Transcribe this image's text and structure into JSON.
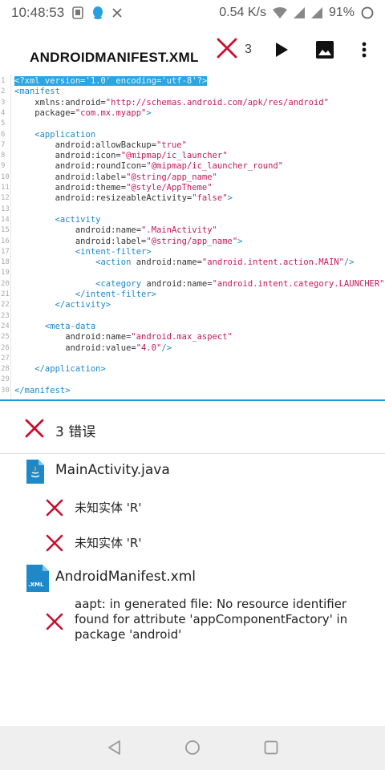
{
  "status_bar": {
    "time": "10:48:53",
    "net_speed": "0.54 K/s",
    "battery": "91%",
    "icons": [
      "file-icon",
      "qq-icon",
      "close-icon",
      "wifi-icon",
      "signal-icon",
      "signal-icon",
      "battery-icon"
    ]
  },
  "toolbar": {
    "title": "ANDROIDMANIFEST.XML",
    "error_count": "3",
    "actions": [
      "error-icon",
      "play-icon",
      "image-icon",
      "more-vert-icon"
    ]
  },
  "editor": {
    "lines": [
      {
        "n": "1",
        "parts": [
          [
            "sel",
            "<?xml version='1.0' encoding='utf-8'?>"
          ]
        ]
      },
      {
        "n": "2",
        "parts": [
          [
            "tag",
            "<manifest"
          ]
        ]
      },
      {
        "n": "3",
        "parts": [
          [
            "attr",
            "    xmlns:android="
          ],
          [
            "val",
            "\"http://schemas.android.com/apk/res/android\""
          ]
        ]
      },
      {
        "n": "4",
        "parts": [
          [
            "attr",
            "    package="
          ],
          [
            "val",
            "\"com.mx.myapp\""
          ],
          [
            "tag",
            ">"
          ]
        ]
      },
      {
        "n": "5",
        "parts": []
      },
      {
        "n": "6",
        "parts": [
          [
            "tag",
            "    <application"
          ]
        ]
      },
      {
        "n": "7",
        "parts": [
          [
            "attr",
            "        android:allowBackup="
          ],
          [
            "val",
            "\"true\""
          ]
        ]
      },
      {
        "n": "8",
        "parts": [
          [
            "attr",
            "        android:icon="
          ],
          [
            "val",
            "\"@mipmap/ic_launcher\""
          ]
        ]
      },
      {
        "n": "9",
        "parts": [
          [
            "attr",
            "        android:roundIcon="
          ],
          [
            "val",
            "\"@mipmap/ic_launcher_round\""
          ]
        ]
      },
      {
        "n": "10",
        "parts": [
          [
            "attr",
            "        android:label="
          ],
          [
            "val",
            "\"@string/app_name\""
          ]
        ]
      },
      {
        "n": "11",
        "parts": [
          [
            "attr",
            "        android:theme="
          ],
          [
            "val",
            "\"@style/AppTheme\""
          ]
        ]
      },
      {
        "n": "12",
        "parts": [
          [
            "attr",
            "        android:resizeableActivity="
          ],
          [
            "val",
            "\"false\""
          ],
          [
            "tag",
            ">"
          ]
        ]
      },
      {
        "n": "13",
        "parts": []
      },
      {
        "n": "14",
        "parts": [
          [
            "tag",
            "        <activity"
          ]
        ]
      },
      {
        "n": "15",
        "parts": [
          [
            "attr",
            "            android:name="
          ],
          [
            "val",
            "\".MainActivity\""
          ]
        ]
      },
      {
        "n": "16",
        "parts": [
          [
            "attr",
            "            android:label="
          ],
          [
            "val",
            "\"@string/app_name\""
          ],
          [
            "tag",
            ">"
          ]
        ]
      },
      {
        "n": "17",
        "parts": [
          [
            "tag",
            "            <intent-filter>"
          ]
        ]
      },
      {
        "n": "18",
        "parts": [
          [
            "tag",
            "                <action "
          ],
          [
            "attr",
            "android:name="
          ],
          [
            "val",
            "\"android.intent.action.MAIN\""
          ],
          [
            "tag",
            "/>"
          ]
        ]
      },
      {
        "n": "19",
        "parts": []
      },
      {
        "n": "20",
        "parts": [
          [
            "tag",
            "                <category "
          ],
          [
            "attr",
            "android:name="
          ],
          [
            "val",
            "\"android.intent.category.LAUNCHER\""
          ],
          [
            "tag",
            "/"
          ]
        ]
      },
      {
        "n": "21",
        "parts": [
          [
            "tag",
            "            </intent-filter>"
          ]
        ]
      },
      {
        "n": "22",
        "parts": [
          [
            "tag",
            "        </activity>"
          ]
        ]
      },
      {
        "n": "23",
        "parts": []
      },
      {
        "n": "24",
        "parts": [
          [
            "tag",
            "      <meta-data"
          ]
        ]
      },
      {
        "n": "25",
        "parts": [
          [
            "attr",
            "          android:name="
          ],
          [
            "val",
            "\"android.max_aspect\""
          ]
        ]
      },
      {
        "n": "26",
        "parts": [
          [
            "attr",
            "          android:value="
          ],
          [
            "val",
            "\"4.0\""
          ],
          [
            "tag",
            "/>"
          ]
        ]
      },
      {
        "n": "27",
        "parts": []
      },
      {
        "n": "28",
        "parts": [
          [
            "tag",
            "    </application>"
          ]
        ]
      },
      {
        "n": "29",
        "parts": []
      },
      {
        "n": "30",
        "parts": [
          [
            "tag",
            "</manifest>"
          ]
        ]
      }
    ]
  },
  "errors": {
    "header": "3 错误",
    "files": [
      {
        "name": "MainActivity.java",
        "icon": "java-file-icon",
        "messages": [
          "未知实体 'R'",
          "未知实体 'R'"
        ]
      },
      {
        "name": "AndroidManifest.xml",
        "icon": "xml-file-icon",
        "icon_label": ".XML",
        "messages": [
          "aapt: in generated file: No resource identifier found for attribute 'appComponentFactory' in package 'android'"
        ]
      }
    ]
  },
  "nav": {
    "buttons": [
      "back-icon",
      "home-icon",
      "recents-icon"
    ]
  },
  "colors": {
    "accent": "#1e9ad6",
    "error": "#c8102e",
    "tag": "#1a88c9",
    "value": "#c2185b"
  }
}
